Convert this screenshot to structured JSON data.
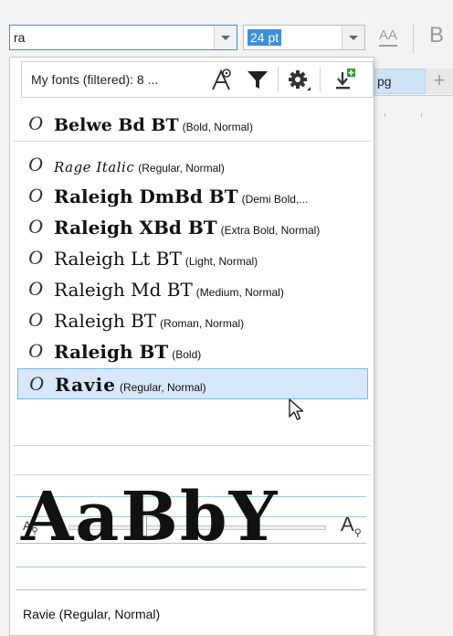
{
  "toolbar": {
    "font_name_value": "ra",
    "font_size_value": "24 pt",
    "char_format_icon_label": "AA",
    "bold_label": "B"
  },
  "background_tab": {
    "label": "pg",
    "add_label": "+"
  },
  "font_panel": {
    "filter_label": "My fonts (filtered): 8 ...",
    "fonts": [
      {
        "name": "Belwe Bd BT",
        "style": "(Bold, Normal)",
        "type_icon": "O",
        "weight": "bold"
      },
      {
        "name": "Rage Italic",
        "style": "(Regular, Normal)",
        "type_icon": "O",
        "weight": "script"
      },
      {
        "name": "Raleigh DmBd BT",
        "style": "(Demi Bold,...",
        "type_icon": "O",
        "weight": "semibold"
      },
      {
        "name": "Raleigh XBd BT",
        "style": "(Extra Bold, Normal)",
        "type_icon": "O",
        "weight": "bold"
      },
      {
        "name": "Raleigh Lt BT",
        "style": "(Light, Normal)",
        "type_icon": "O",
        "weight": "light"
      },
      {
        "name": "Raleigh Md BT",
        "style": "(Medium, Normal)",
        "type_icon": "O",
        "weight": "normal"
      },
      {
        "name": "Raleigh BT",
        "style": "(Roman, Normal)",
        "type_icon": "O",
        "weight": "normal"
      },
      {
        "name": "Raleigh BT",
        "style": "(Bold)",
        "type_icon": "O",
        "weight": "bold"
      },
      {
        "name": "Ravie",
        "style": "(Regular, Normal)",
        "type_icon": "O",
        "weight": "display",
        "selected": true
      }
    ],
    "zoom_small_label": "A",
    "zoom_large_label": "A",
    "zoom_level": 0.27,
    "preview_text": "AaBbY",
    "preview_font_name": "Ravie (Regular, Normal)"
  },
  "colors": {
    "accent": "#3d8fd8",
    "selection": "#d6e8fa",
    "selection_border": "#7db5e6",
    "add_font_icon": "#2e9a2e"
  }
}
